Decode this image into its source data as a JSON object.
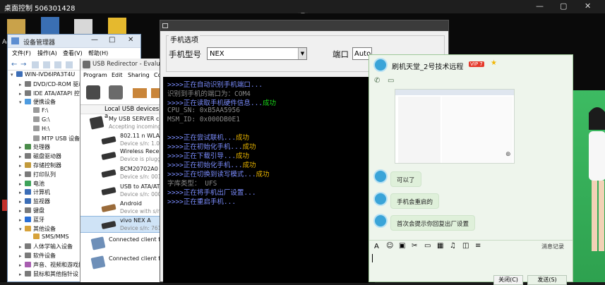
{
  "remote_desktop": {
    "title": "桌面控制 506301428"
  },
  "desktop_icon_text": "Ac",
  "device_manager": {
    "title": "设备管理器",
    "menu": [
      "文件(F)",
      "操作(A)",
      "查看(V)",
      "帮助(H)"
    ],
    "tree": [
      {
        "label": "WIN-IVD6IPA3T4U",
        "indent": 0
      },
      {
        "label": "DVD/CD-ROM 驱动器",
        "indent": 1
      },
      {
        "label": "IDE ATA/ATAPI 控",
        "indent": 1
      },
      {
        "label": "便携设备",
        "indent": 1
      },
      {
        "label": "F:\\",
        "indent": 2
      },
      {
        "label": "G:\\",
        "indent": 2
      },
      {
        "label": "H:\\",
        "indent": 2
      },
      {
        "label": "MTP USB 设备",
        "indent": 2
      },
      {
        "label": "处理器",
        "indent": 1
      },
      {
        "label": "磁盘驱动器",
        "indent": 1
      },
      {
        "label": "存储控制器",
        "indent": 1
      },
      {
        "label": "打印队列",
        "indent": 1
      },
      {
        "label": "电池",
        "indent": 1
      },
      {
        "label": "计算机",
        "indent": 1
      },
      {
        "label": "监视器",
        "indent": 1
      },
      {
        "label": "键盘",
        "indent": 1
      },
      {
        "label": "蓝牙",
        "indent": 1
      },
      {
        "label": "其他设备",
        "indent": 1
      },
      {
        "label": "SMS/MMS",
        "indent": 2
      },
      {
        "label": "人体学输入设备",
        "indent": 1
      },
      {
        "label": "软件设备",
        "indent": 1
      },
      {
        "label": "声音、视频和游戏控",
        "indent": 1
      },
      {
        "label": "鼠标和其他指针设",
        "indent": 1
      }
    ]
  },
  "usb_redirector": {
    "title": "USB Redirector - Evaluatio",
    "menu": [
      "Program",
      "Edit",
      "Sharing",
      "Co"
    ],
    "list_header": "Local USB devices a",
    "devices": [
      {
        "name": "My USB SERVER co",
        "sub": "Accepting incoming"
      },
      {
        "name": "802.11 n WLAN",
        "sub": "Device s/n: 1.0"
      },
      {
        "name": "Wireless Receiv",
        "sub": "Device is plugge"
      },
      {
        "name": "BCM20702A0",
        "sub": "Device s/n: 001"
      },
      {
        "name": "USB to ATA/ATA",
        "sub": "Device s/n: 000"
      },
      {
        "name": "Android",
        "sub": "Device with s/n"
      },
      {
        "name": "vivo NEX A",
        "sub": "Device s/n: 761"
      },
      {
        "name": "Connected client fro",
        "sub": ""
      },
      {
        "name": "Connected client fro",
        "sub": ""
      }
    ]
  },
  "flasher": {
    "section_title": "手机选项",
    "model_label": "手机型号",
    "model_value": "NEX",
    "port_label": "端口",
    "port_value": "Auto",
    "console": [
      {
        "text": ">>>>正在自动识别手机端口...",
        "color": "#7b8dff"
      },
      {
        "text": "   识别到手机的端口为：COM4",
        "color": "#888888"
      },
      {
        "text": ">>>>正在读取手机硬件信息...",
        "color": "#7b8dff",
        "suffix": "成功",
        "suffix_color": "#19d619"
      },
      {
        "text": "   CPU_SN:  0xB5AA5956",
        "color": "#888888"
      },
      {
        "text": "   MSM_ID:  0x000DB0E1",
        "color": "#888888"
      },
      {
        "text": ">>>>正在尝试联机...",
        "color": "#7b8dff",
        "suffix": "成功",
        "suffix_color": "#e8b400"
      },
      {
        "text": ">>>>正在初始化手机...",
        "color": "#7b8dff",
        "suffix": "成功",
        "suffix_color": "#e8b400"
      },
      {
        "text": ">>>>正在下载引导...",
        "color": "#7b8dff",
        "suffix": "成功",
        "suffix_color": "#e8b400"
      },
      {
        "text": ">>>>正在初始化手机...",
        "color": "#7b8dff",
        "suffix": "成功",
        "suffix_color": "#e8b400"
      },
      {
        "text": ">>>>正在切换到读写模式...",
        "color": "#7b8dff",
        "suffix": "成功",
        "suffix_color": "#e8b400"
      },
      {
        "text": "   字库类型：  UFS",
        "color": "#888888"
      },
      {
        "text": ">>>>正在将手机出厂设置...",
        "color": "#7b8dff"
      },
      {
        "text": ">>>>正在重启手机...",
        "color": "#7b8dff"
      }
    ]
  },
  "chat": {
    "title": "刷机天堂_2号技术远程",
    "badge": "VIP 7",
    "messages": [
      "可以了",
      "手机会重启的",
      "首次会提示你回复出厂设置"
    ],
    "history_label": "消息记录",
    "close_label": "关闭(C)",
    "send_label": "发送(S)"
  }
}
